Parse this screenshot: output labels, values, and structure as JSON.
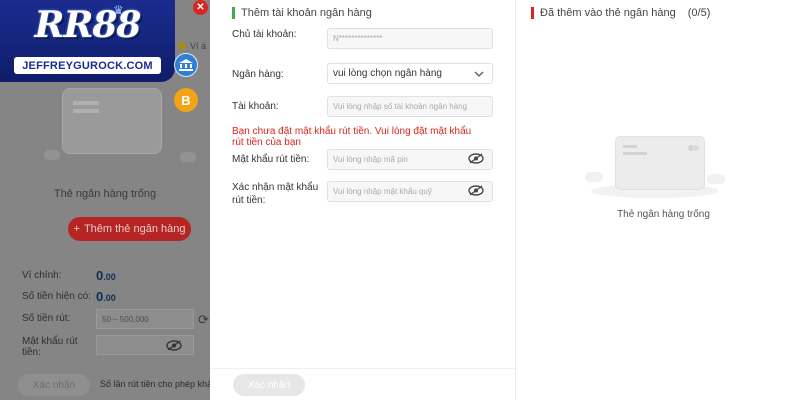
{
  "logo": {
    "main": "RR88",
    "sub": "JEFFREYGUROCK.COM"
  },
  "background": {
    "partial_text": "Ví á",
    "empty_text": "Thẻ ngân hàng trống",
    "add_button_label": "Thêm thẻ ngân hàng",
    "main_wallet_label": "Ví chính:",
    "main_wallet_value": "0",
    "main_wallet_decimal": ".00",
    "current_balance_label": "Số tiền hiện có:",
    "current_balance_value": "0",
    "current_balance_decimal": ".00",
    "withdraw_amount_label": "Số tiền rút:",
    "withdraw_amount_placeholder": "50 – 500,000",
    "withdraw_pin_label": "Mật khẩu rút tiền:",
    "submit_label": "Xác nhận",
    "note": "Số lần rút tiền cho phép khả"
  },
  "modal": {
    "left_title": "Thêm tài khoản ngân hàng",
    "fields": {
      "holder_label": "Chủ tài khoản:",
      "holder_value": "N**************",
      "bank_label": "Ngân hàng:",
      "bank_value": "vui lòng chọn ngân hàng",
      "account_label": "Tài khoản:",
      "account_placeholder": "Vui lòng nhập số tài khoản ngân hàng",
      "pin_label": "Mật khẩu rút tiền:",
      "pin_placeholder": "Vui lòng nhập mã pin",
      "pin_confirm_label": "Xác nhận mật khẩu rút tiền:",
      "pin_confirm_placeholder": "Vui lòng nhập mật khẩu quỹ"
    },
    "warning": "Bạn chưa đặt mật khẩu rút tiền. Vui lòng đặt mật khẩu rút tiền của bạn",
    "submit_label": "Xác nhận",
    "right_title": "Đã thêm vào thẻ ngân hàng",
    "right_count": "(0/5)",
    "right_empty_text": "Thẻ ngân hàng trống"
  },
  "colors": {
    "accent_green": "#3fae49",
    "accent_red": "#d9251f",
    "brand_blue": "#1b2c8f"
  },
  "icons": [
    "close-icon",
    "bank-icon",
    "bitcoin-icon",
    "eye-slash-icon",
    "chevron-down-icon",
    "refresh-icon",
    "plus-icon"
  ]
}
